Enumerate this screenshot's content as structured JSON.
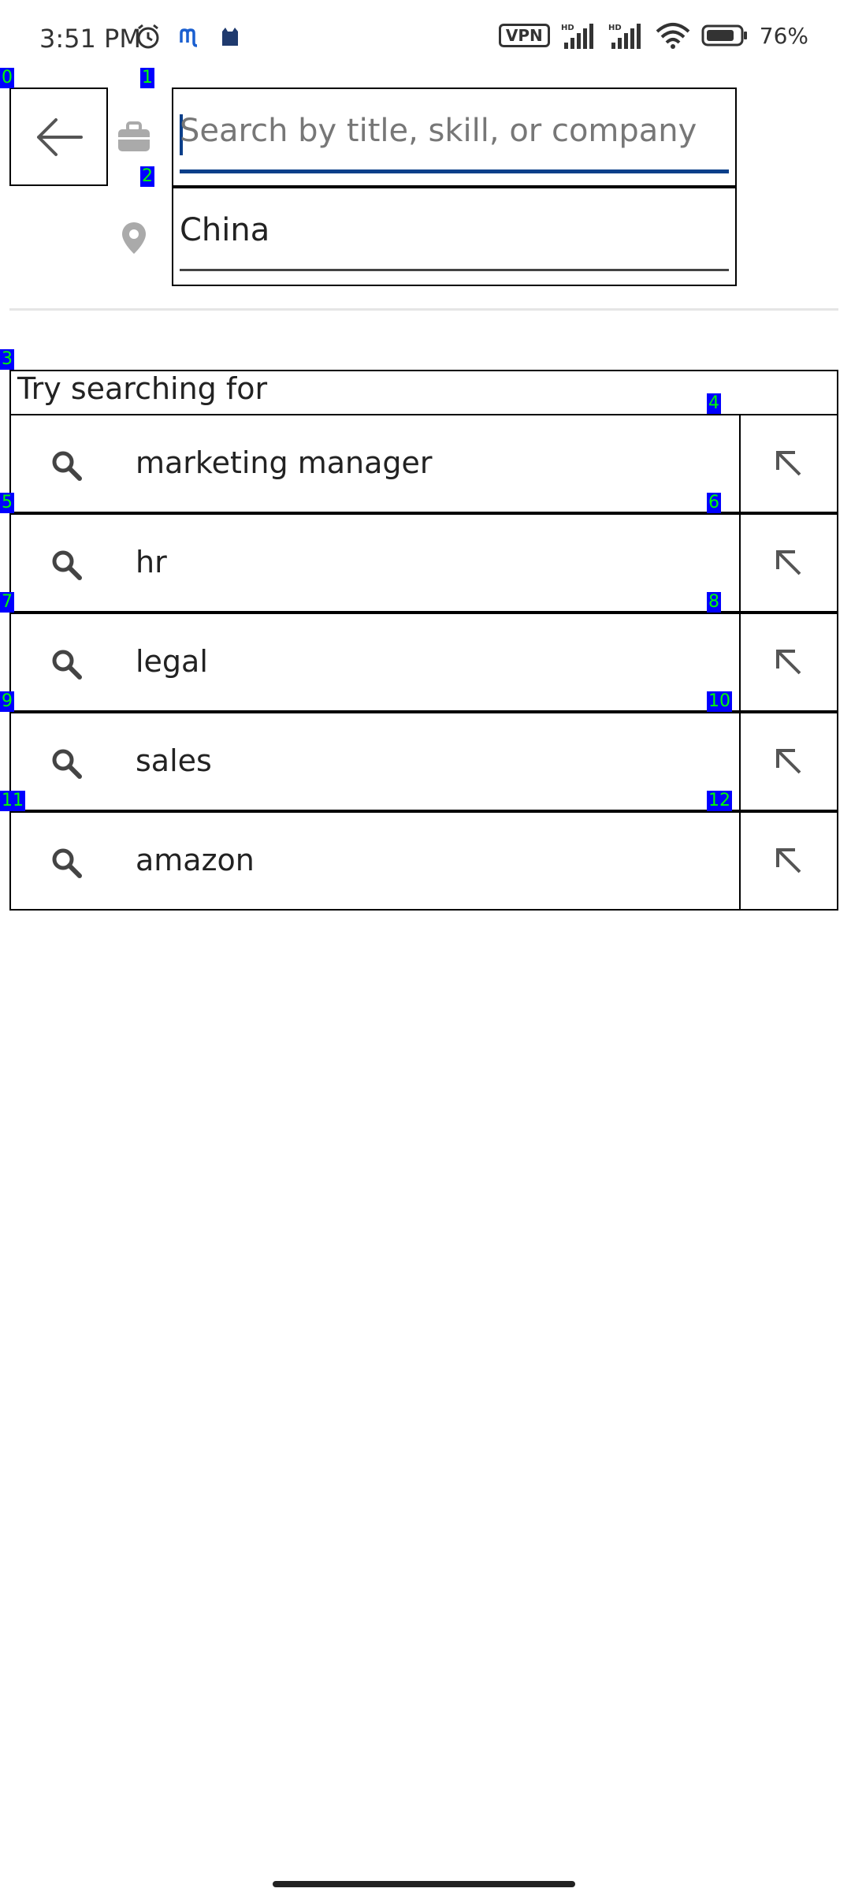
{
  "status_bar": {
    "time": "3:51 PM",
    "vpn": "VPN",
    "battery": "76%"
  },
  "search": {
    "keyword_placeholder": "Search by title, skill, or company",
    "location_value": "China"
  },
  "suggestions": {
    "header": "Try searching for",
    "items": [
      {
        "label": "marketing manager"
      },
      {
        "label": "hr"
      },
      {
        "label": "legal"
      },
      {
        "label": "sales"
      },
      {
        "label": "amazon"
      }
    ]
  },
  "overlay_tags": [
    "0",
    "1",
    "2",
    "3",
    "4",
    "5",
    "6",
    "7",
    "8",
    "9",
    "10",
    "11",
    "12"
  ],
  "colors": {
    "accent": "#0a3f8a",
    "tag_bg": "#0000ff",
    "tag_text": "#00ff00"
  }
}
